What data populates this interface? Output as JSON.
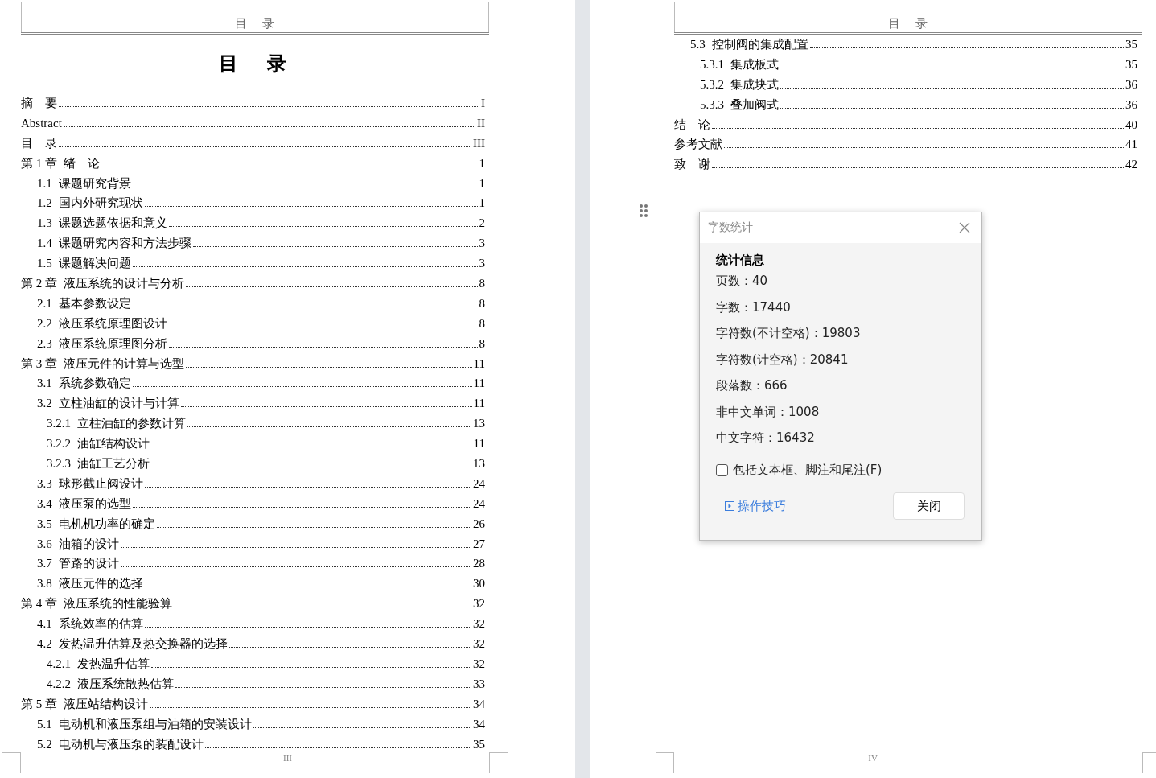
{
  "pages": [
    {
      "header": "目　录",
      "title": "目　录",
      "footer": "- III -",
      "toc": [
        {
          "title": "摘　要",
          "page": "I"
        },
        {
          "title": "Abstract",
          "page": "II"
        },
        {
          "title": "目　录",
          "page": "III"
        },
        {
          "number": "第 1 章",
          "title": "绪　论",
          "page": "1",
          "children": [
            {
              "number": "1.1",
              "title": "课题研究背景",
              "page": "1"
            },
            {
              "number": "1.2",
              "title": "国内外研究现状",
              "page": "1"
            },
            {
              "number": "1.3",
              "title": "课题选题依据和意义",
              "page": "2"
            },
            {
              "number": "1.4",
              "title": "课题研究内容和方法步骤",
              "page": "3"
            },
            {
              "number": "1.5",
              "title": "课题解决问题",
              "page": "3"
            }
          ]
        },
        {
          "number": "第 2 章",
          "title": "液压系统的设计与分析",
          "page": "8",
          "children": [
            {
              "number": "2.1",
              "title": "基本参数设定",
              "page": "8"
            },
            {
              "number": "2.2",
              "title": "液压系统原理图设计",
              "page": "8"
            },
            {
              "number": "2.3",
              "title": "液压系统原理图分析",
              "page": "8"
            }
          ]
        },
        {
          "number": "第 3 章",
          "title": "液压元件的计算与选型",
          "page": "11",
          "children": [
            {
              "number": "3.1",
              "title": "系统参数确定",
              "page": "11"
            },
            {
              "number": "3.2",
              "title": "立柱油缸的设计与计算",
              "page": "11",
              "children": [
                {
                  "number": "3.2.1",
                  "title": "立柱油缸的参数计算",
                  "page": "13"
                },
                {
                  "number": "3.2.2",
                  "title": "油缸结构设计",
                  "page": "11"
                },
                {
                  "number": "3.2.3",
                  "title": "油缸工艺分析",
                  "page": "13"
                }
              ]
            },
            {
              "number": "3.3",
              "title": "球形截止阀设计",
              "page": "24"
            },
            {
              "number": "3.4",
              "title": "液压泵的选型",
              "page": "24"
            },
            {
              "number": "3.5",
              "title": "电机机功率的确定",
              "page": "26"
            },
            {
              "number": "3.6",
              "title": "油箱的设计",
              "page": "27"
            },
            {
              "number": "3.7",
              "title": "管路的设计",
              "page": "28"
            },
            {
              "number": "3.8",
              "title": "液压元件的选择",
              "page": "30"
            }
          ]
        },
        {
          "number": "第 4 章",
          "title": "液压系统的性能验算",
          "page": "32",
          "children": [
            {
              "number": "4.1",
              "title": "系统效率的估算",
              "page": "32"
            },
            {
              "number": "4.2",
              "title": "发热温升估算及热交换器的选择",
              "page": "32",
              "children": [
                {
                  "number": "4.2.1",
                  "title": "发热温升估算",
                  "page": "32"
                },
                {
                  "number": "4.2.2",
                  "title": "液压系统散热估算",
                  "page": "33"
                }
              ]
            }
          ]
        },
        {
          "number": "第 5 章",
          "title": "液压站结构设计",
          "page": "34",
          "children": [
            {
              "number": "5.1",
              "title": "电动机和液压泵组与油箱的安装设计",
              "page": "34"
            },
            {
              "number": "5.2",
              "title": "电动机与液压泵的装配设计",
              "page": "35"
            }
          ]
        }
      ]
    },
    {
      "header": "目　录",
      "footer": "- IV -",
      "toc": [
        {
          "children": [
            {
              "number": "5.3",
              "title": "控制阀的集成配置",
              "page": "35",
              "children": [
                {
                  "number": "5.3.1",
                  "title": "集成板式",
                  "page": "35"
                },
                {
                  "number": "5.3.2",
                  "title": "集成块式",
                  "page": "36"
                },
                {
                  "number": "5.3.3",
                  "title": "叠加阀式",
                  "page": "36"
                }
              ]
            }
          ]
        },
        {
          "title": "结　论",
          "page": "40"
        },
        {
          "title": "参考文献",
          "page": "41"
        },
        {
          "title": "致　谢",
          "page": "42"
        }
      ]
    }
  ],
  "dialog": {
    "title": "字数统计",
    "heading": "统计信息",
    "stats": [
      "页数：40",
      "字数：17440",
      "字符数(不计空格)：19803",
      "字符数(计空格)：20841",
      "段落数：666",
      "非中文单词：1008",
      "中文字符：16432"
    ],
    "checkbox": {
      "label": "包括文本框、脚注和尾注(F)",
      "checked": false
    },
    "link": "操作技巧",
    "button": "关闭"
  }
}
